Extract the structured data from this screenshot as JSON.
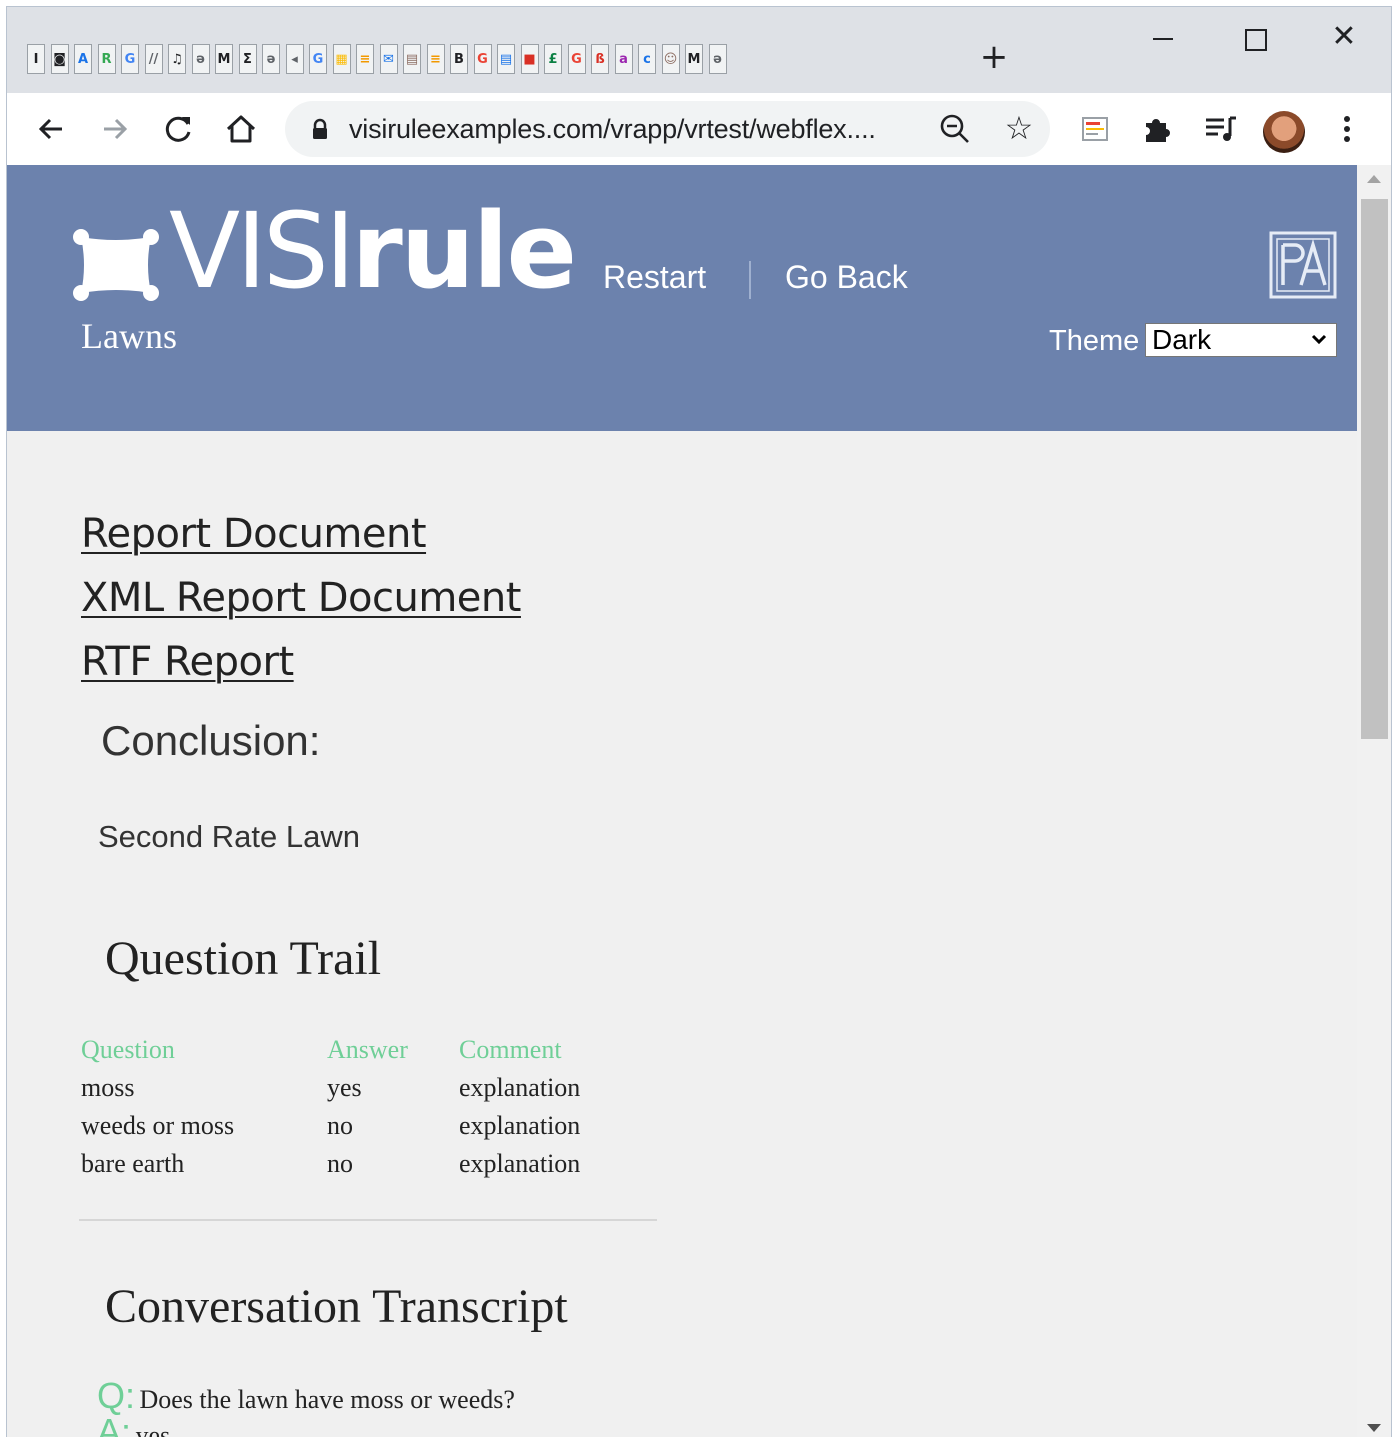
{
  "browser": {
    "tab_favicons": [
      "I",
      "◙",
      "A",
      "R",
      "G",
      "//",
      "♫",
      "ə",
      "M",
      "Σ",
      "ə",
      "◂",
      "G",
      "▦",
      "≡",
      "✉",
      "▤",
      "≡",
      "B",
      "G",
      "▤",
      "■",
      "£",
      "G",
      "ß",
      "a",
      "c",
      "☺",
      "M",
      "ə"
    ],
    "tab_favicon_colors": [
      "#202124",
      "#202124",
      "#1a73e8",
      "#34a853",
      "#4285f4",
      "#5f6368",
      "#202124",
      "#5f6368",
      "#202124",
      "#202124",
      "#5f6368",
      "#5f6368",
      "#4285f4",
      "#fbbc05",
      "#f29900",
      "#1a73e8",
      "#8d6e63",
      "#f29900",
      "#202124",
      "#ea4335",
      "#1a73e8",
      "#d93025",
      "#0b8043",
      "#ea4335",
      "#d93025",
      "#9c27b0",
      "#1a73e8",
      "#8d6e63",
      "#202124",
      "#5f6368"
    ],
    "new_tab_label": "+",
    "url": "visiruleexamples.com/vrapp/vrtest/webflex....",
    "icons": {
      "back": "arrow-left-icon",
      "forward": "arrow-right-icon",
      "reload": "reload-icon",
      "home": "home-icon",
      "lock": "lock-icon",
      "zoom": "zoom-icon",
      "bookmark": "star-icon",
      "extension": "puzzle-icon",
      "media": "media-queue-icon",
      "menu": "menu-dots-icon"
    }
  },
  "header": {
    "logo_thin": "VISI",
    "logo_bold": "rule",
    "subtitle": "Lawns",
    "nav": {
      "restart": "Restart",
      "go_back": "Go Back"
    },
    "theme_label": "Theme",
    "theme_selected": "Dark",
    "background": "#6c82ad"
  },
  "links": {
    "report": "Report Document",
    "xml": "XML Report Document",
    "rtf": "RTF Report"
  },
  "conclusion": {
    "heading": "Conclusion:",
    "value": "Second Rate Lawn"
  },
  "question_trail": {
    "heading": "Question Trail",
    "columns": [
      "Question",
      "Answer",
      "Comment"
    ],
    "rows": [
      [
        "moss",
        "yes",
        "explanation"
      ],
      [
        "weeds or moss",
        "no",
        "explanation"
      ],
      [
        "bare earth",
        "no",
        "explanation"
      ]
    ],
    "accent": "#6fcf97"
  },
  "transcript": {
    "heading": "Conversation Transcript",
    "q_marker": "Q:",
    "a_marker": "A:",
    "q1": "Does the lawn have moss or weeds?",
    "a1": "yes"
  }
}
